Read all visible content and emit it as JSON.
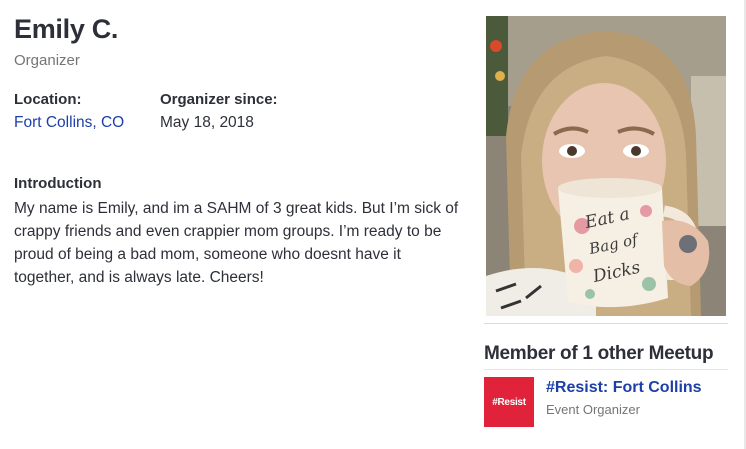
{
  "profile": {
    "name": "Emily C.",
    "role": "Organizer",
    "location_label": "Location:",
    "location_value": "Fort Collins, CO",
    "organizer_since_label": "Organizer since:",
    "organizer_since_value": "May 18, 2018",
    "intro_heading": "Introduction",
    "intro_text": "My name is Emily, and im a SAHM of 3 great kids. But I’m sick of crappy friends and even crappier mom groups. I’m ready to be proud of being a bad mom, someone who doesnt have it together, and is always late. Cheers!"
  },
  "photo": {
    "mug_text": [
      "Eat a",
      "Bag of",
      "Dicks"
    ]
  },
  "memberships": {
    "heading": "Member of 1 other Meetup",
    "groups": [
      {
        "logo_text": "#Resist",
        "name": "#Resist: Fort Collins",
        "role": "Event Organizer"
      }
    ]
  },
  "colors": {
    "link": "#1d3fa8",
    "muted": "#757575",
    "text": "#2e3039",
    "logo_bg": "#e0233b"
  }
}
